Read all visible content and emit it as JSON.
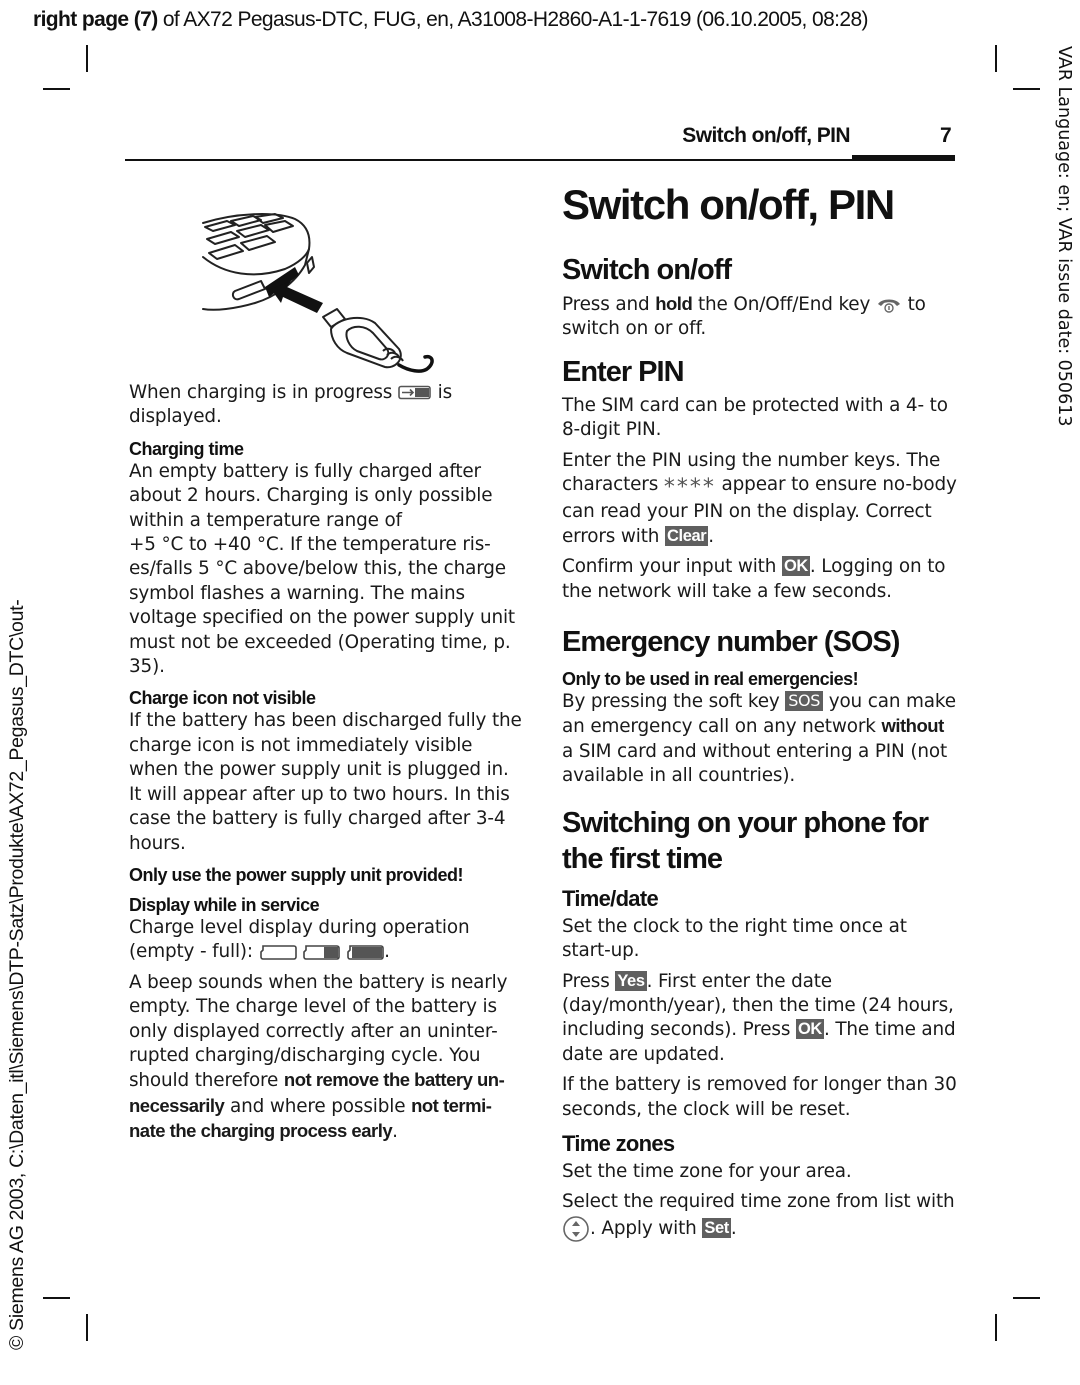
{
  "meta_header": {
    "bold": "right page (7)",
    "rest": " of AX72 Pegasus-DTC, FUG, en, A31008-H2860-A1-1-7619 (06.10.2005, 08:28)"
  },
  "side_left": "© Siemens AG 2003, C:\\Daten_itl\\Siemens\\DTP-Satz\\Produkte\\AX72_Pegasus_DTC\\out-",
  "side_right": "VAR Language: en; VAR issue date: 050613",
  "running_head": {
    "title": "Switch on/off, PIN",
    "page": "7"
  },
  "left": {
    "illustration": "phone-charger-plug-icon",
    "charging_intro": {
      "before": "When charging is in progress ",
      "icon": "charging-battery-icon",
      "after": " is displayed."
    },
    "charging_time": {
      "heading": "Charging time",
      "text": "An empty battery is fully charged after about 2 hours. Charging is only possible within a temperature range of",
      "text2": "+5 °C to +40 °C. If the temperature ris-es/falls 5 °C above/below this, the charge symbol flashes a warning. The mains voltage specified on the power supply unit must not be exceeded (Operating time, p. 35)."
    },
    "charge_icon": {
      "heading": "Charge icon not visible",
      "text": "If the battery has been discharged fully the charge icon is not immediately visible when the power supply unit is plugged in. It will appear after up to two hours. In this case the battery is fully charged after 3-4 hours."
    },
    "warning": "Only use the power supply unit provided!",
    "display": {
      "heading": "Display while in service",
      "text_before": "Charge level display during operation (empty - full): ",
      "battery_levels": [
        "empty",
        "half",
        "full"
      ],
      "text_after": ".",
      "beep_text": "A beep sounds when the battery is nearly empty. The charge level of the battery is only displayed correctly after an uninter-rupted charging/discharging cycle. You should therefore ",
      "beep_bold1": "not remove the battery un-necessarily",
      "beep_mid": " and where possible ",
      "beep_bold2": "not termi-nate the charging process early",
      "beep_end": "."
    }
  },
  "right": {
    "title": "Switch on/off, PIN",
    "switch": {
      "heading": "Switch on/off",
      "t1": "Press and ",
      "bold": "hold",
      "t2": " the On/Off/End key ",
      "icon": "end-key-icon",
      "t3": " to switch on or off."
    },
    "pin": {
      "heading": "Enter PIN",
      "p1": "The SIM card can be protected with a 4- to 8-digit PIN.",
      "p2a": "Enter the PIN using the number keys. The characters ",
      "stars": "****",
      "p2b": " appear to ensure no-body can read your PIN on the display. Correct errors with ",
      "key_clear": "Clear",
      "p2c": ".",
      "p3a": "Confirm your input with ",
      "key_ok": "OK",
      "p3b": ". Logging on to the network will take a few seconds."
    },
    "sos": {
      "heading": "Emergency number (SOS)",
      "warning": "Only to be used in real emergencies!",
      "t1": "By pressing the soft key ",
      "key": "SOS",
      "t2": " you can make an emergency call on any network ",
      "bold": "without",
      "t3": " a SIM card and without entering a PIN (not available in all countries)."
    },
    "first_time": {
      "heading": "Switching on your phone for the first time",
      "time_date": {
        "heading": "Time/date",
        "p1": "Set the clock to the right time once at start-up.",
        "p2a": "Press ",
        "key_yes": "Yes",
        "p2b": ". First enter the date (day/month/year), then the time (24 hours, including seconds). Press ",
        "key_ok": "OK",
        "p2c": ". The time and date are updated.",
        "p3": "If the battery is removed for longer than 30 seconds, the clock will be reset."
      },
      "time_zones": {
        "heading": "Time zones",
        "p1": "Set the time zone for your area.",
        "p2a": "Select the required time zone from list with ",
        "icon": "navigation-key-updown-icon",
        "p2b": ". Apply with ",
        "key_set": "Set",
        "p2c": "."
      }
    }
  }
}
